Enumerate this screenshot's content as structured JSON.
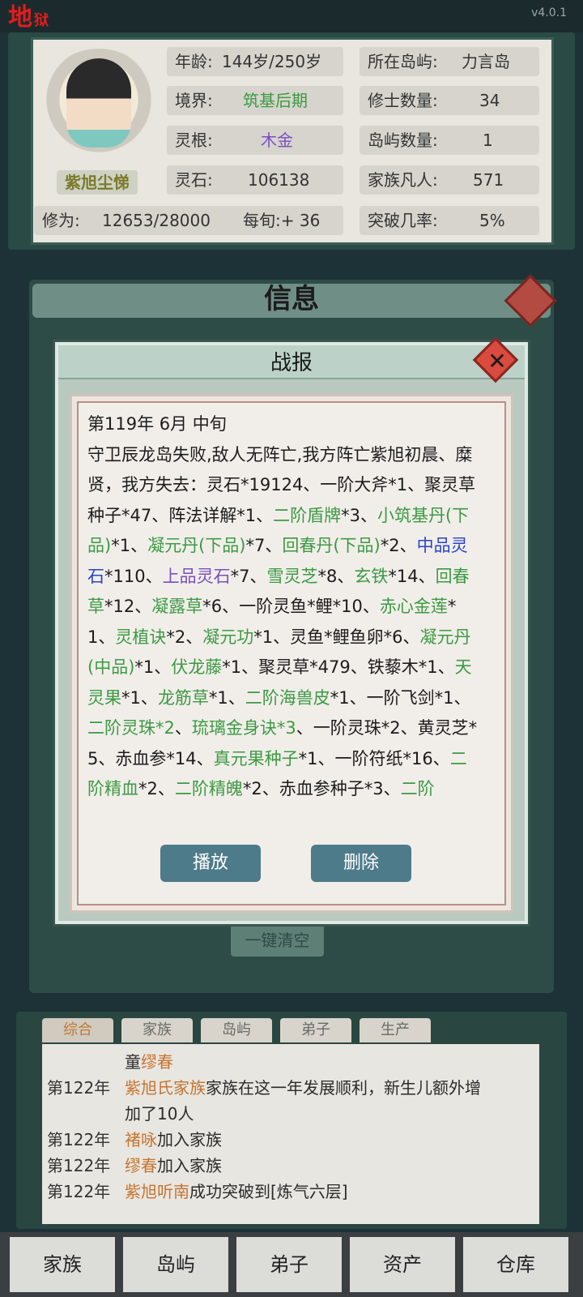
{
  "app": {
    "logo": "地",
    "logo_sub": "狱",
    "version": "v4.0.1"
  },
  "character": {
    "name": "紫旭尘悌",
    "stats": [
      {
        "label": "年龄:",
        "value": "144岁/250岁"
      },
      {
        "label": "所在岛屿:",
        "value": "力言岛"
      },
      {
        "label": "境界:",
        "value": "筑基后期"
      },
      {
        "label": "修士数量:",
        "value": "34"
      },
      {
        "label": "灵根:",
        "value": "木金"
      },
      {
        "label": "岛屿数量:",
        "value": "1"
      },
      {
        "label": "灵石:",
        "value": "106138"
      },
      {
        "label": "家族凡人:",
        "value": "571"
      },
      {
        "label": "突破几率:",
        "value": "5%"
      }
    ],
    "cultivation_label": "修为:",
    "cultivation_value": "12653/28000",
    "per_round": "每旬:+ 36"
  },
  "colors": {
    "realm": "#3c9a43",
    "root": "#7a4fc1",
    "accent_red": "#d94a3f"
  },
  "info_window": {
    "title": "信息",
    "clear_button": "一键清空"
  },
  "report": {
    "title": "战报",
    "date": "第119年 6月 中旬",
    "segments": [
      {
        "t": "守卫辰龙岛失败,敌人无阵亡,我方阵亡紫旭初晨、糜贤，我方失去：灵石*19124、一阶大斧*1、聚灵草种子*47、阵法详解*1、",
        "c": ""
      },
      {
        "t": "二阶盾牌",
        "c": "green"
      },
      {
        "t": "*3、",
        "c": ""
      },
      {
        "t": "小筑基丹(下品)",
        "c": "green"
      },
      {
        "t": "*1、",
        "c": ""
      },
      {
        "t": "凝元丹(下品)",
        "c": "green"
      },
      {
        "t": "*7、",
        "c": ""
      },
      {
        "t": "回春丹(下品)",
        "c": "green"
      },
      {
        "t": "*2、",
        "c": ""
      },
      {
        "t": "中品灵石",
        "c": "blue"
      },
      {
        "t": "*110、",
        "c": ""
      },
      {
        "t": "上品灵石",
        "c": "purple"
      },
      {
        "t": "*7、",
        "c": ""
      },
      {
        "t": "雪灵芝",
        "c": "green"
      },
      {
        "t": "*8、",
        "c": ""
      },
      {
        "t": "玄铁",
        "c": "green"
      },
      {
        "t": "*14、",
        "c": ""
      },
      {
        "t": "回春草",
        "c": "green"
      },
      {
        "t": "*12、",
        "c": ""
      },
      {
        "t": "凝露草",
        "c": "green"
      },
      {
        "t": "*6、一阶灵鱼*鲤*10、",
        "c": ""
      },
      {
        "t": "赤心金莲",
        "c": "green"
      },
      {
        "t": "*1、",
        "c": ""
      },
      {
        "t": "灵植诀",
        "c": "green"
      },
      {
        "t": "*2、",
        "c": ""
      },
      {
        "t": "凝元功",
        "c": "green"
      },
      {
        "t": "*1、灵鱼*鲤鱼卵*6、",
        "c": ""
      },
      {
        "t": "凝元丹(中品)",
        "c": "green"
      },
      {
        "t": "*1、",
        "c": ""
      },
      {
        "t": "伏龙藤",
        "c": "green"
      },
      {
        "t": "*1、聚灵草*479、铁藜木*1、",
        "c": ""
      },
      {
        "t": "天灵果",
        "c": "green"
      },
      {
        "t": "*1、",
        "c": ""
      },
      {
        "t": "龙筋草",
        "c": "green"
      },
      {
        "t": "*1、",
        "c": ""
      },
      {
        "t": "二阶海兽皮",
        "c": "green"
      },
      {
        "t": "*1、一阶飞剑*1、",
        "c": ""
      },
      {
        "t": "二阶灵珠*2",
        "c": "green"
      },
      {
        "t": "、",
        "c": ""
      },
      {
        "t": "琉璃金身诀*3",
        "c": "green"
      },
      {
        "t": "、一阶灵珠*2、黄灵芝*5、赤血参*14、",
        "c": ""
      },
      {
        "t": "真元果种子",
        "c": "green"
      },
      {
        "t": "*1、一阶符纸*16、",
        "c": ""
      },
      {
        "t": "二阶精血",
        "c": "green"
      },
      {
        "t": "*2、",
        "c": ""
      },
      {
        "t": "二阶精魄",
        "c": "green"
      },
      {
        "t": "*2、赤血参种子*3、",
        "c": ""
      },
      {
        "t": "二阶",
        "c": "green"
      }
    ],
    "play_button": "播放",
    "delete_button": "删除"
  },
  "log": {
    "tabs": [
      "综合",
      "家族",
      "岛屿",
      "弟子",
      "生产"
    ],
    "entries": [
      {
        "year": "",
        "parts": [
          {
            "t": "童",
            "c": ""
          },
          {
            "t": "缪春",
            "c": "orange"
          }
        ]
      },
      {
        "year": "第122年",
        "parts": [
          {
            "t": "紫旭氏家族",
            "c": "orange"
          },
          {
            "t": "家族在这一年发展顺利，新生儿额外增",
            "c": ""
          }
        ]
      },
      {
        "year": "",
        "parts": [
          {
            "t": "加了10人",
            "c": ""
          }
        ]
      },
      {
        "year": "第122年",
        "parts": [
          {
            "t": "褚咏",
            "c": "orange"
          },
          {
            "t": "加入家族",
            "c": ""
          }
        ]
      },
      {
        "year": "第122年",
        "parts": [
          {
            "t": "缪春",
            "c": "orange"
          },
          {
            "t": "加入家族",
            "c": ""
          }
        ]
      },
      {
        "year": "第122年",
        "parts": [
          {
            "t": "紫旭听南",
            "c": "orange"
          },
          {
            "t": "成功突破到[炼气六层]",
            "c": ""
          }
        ]
      }
    ]
  },
  "nav": [
    "家族",
    "岛屿",
    "弟子",
    "资产",
    "仓库"
  ]
}
